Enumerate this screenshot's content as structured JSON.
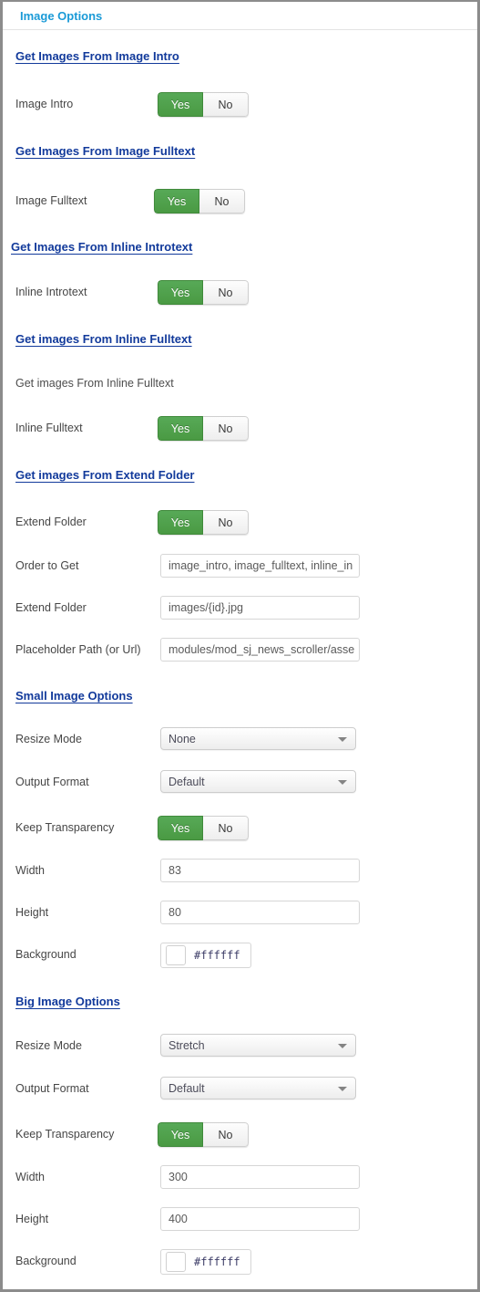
{
  "panel": {
    "title": "Image Options"
  },
  "toggle": {
    "yes": "Yes",
    "no": "No"
  },
  "sections": [
    {
      "key": "image_intro",
      "heading": "Get Images From Image Intro",
      "rows": [
        {
          "label": "Image Intro",
          "type": "toggle",
          "value": "Yes"
        }
      ]
    },
    {
      "key": "image_fulltext",
      "heading": "Get Images From Image Fulltext",
      "rows": [
        {
          "label": "Image Fulltext",
          "type": "toggle",
          "value": "Yes"
        }
      ]
    },
    {
      "key": "inline_introtext",
      "heading": "Get Images From Inline Introtext",
      "rows": [
        {
          "label": "Inline Introtext",
          "type": "toggle",
          "value": "Yes"
        }
      ]
    },
    {
      "key": "inline_fulltext",
      "heading": "Get images From Inline Fulltext",
      "description": "Get images From Inline Fulltext",
      "rows": [
        {
          "label": "Inline Fulltext",
          "type": "toggle",
          "value": "Yes"
        }
      ]
    },
    {
      "key": "extend_folder",
      "heading": "Get images From Extend Folder",
      "rows": [
        {
          "label": "Extend Folder",
          "type": "toggle",
          "value": "Yes"
        },
        {
          "label": "Order to Get",
          "type": "text",
          "value": "image_intro, image_fulltext, inline_in"
        },
        {
          "label": "Extend Folder",
          "type": "text",
          "value": "images/{id}.jpg"
        },
        {
          "label": "Placeholder Path (or Url)",
          "type": "text",
          "value": "modules/mod_sj_news_scroller/asse"
        }
      ]
    },
    {
      "key": "small_image",
      "heading": "Small Image Options",
      "rows": [
        {
          "label": "Resize Mode",
          "type": "select",
          "value": "None"
        },
        {
          "label": "Output Format",
          "type": "select",
          "value": "Default"
        },
        {
          "label": "Keep Transparency",
          "type": "toggle",
          "value": "Yes"
        },
        {
          "label": "Width",
          "type": "text",
          "value": "83"
        },
        {
          "label": "Height",
          "type": "text",
          "value": "80"
        },
        {
          "label": "Background",
          "type": "color",
          "value": "#ffffff"
        }
      ]
    },
    {
      "key": "big_image",
      "heading": "Big Image Options",
      "rows": [
        {
          "label": "Resize Mode",
          "type": "select",
          "value": "Stretch"
        },
        {
          "label": "Output Format",
          "type": "select",
          "value": "Default"
        },
        {
          "label": "Keep Transparency",
          "type": "toggle",
          "value": "Yes"
        },
        {
          "label": "Width",
          "type": "text",
          "value": "300"
        },
        {
          "label": "Height",
          "type": "text",
          "value": "400"
        },
        {
          "label": "Background",
          "type": "color",
          "value": "#ffffff"
        }
      ]
    }
  ]
}
